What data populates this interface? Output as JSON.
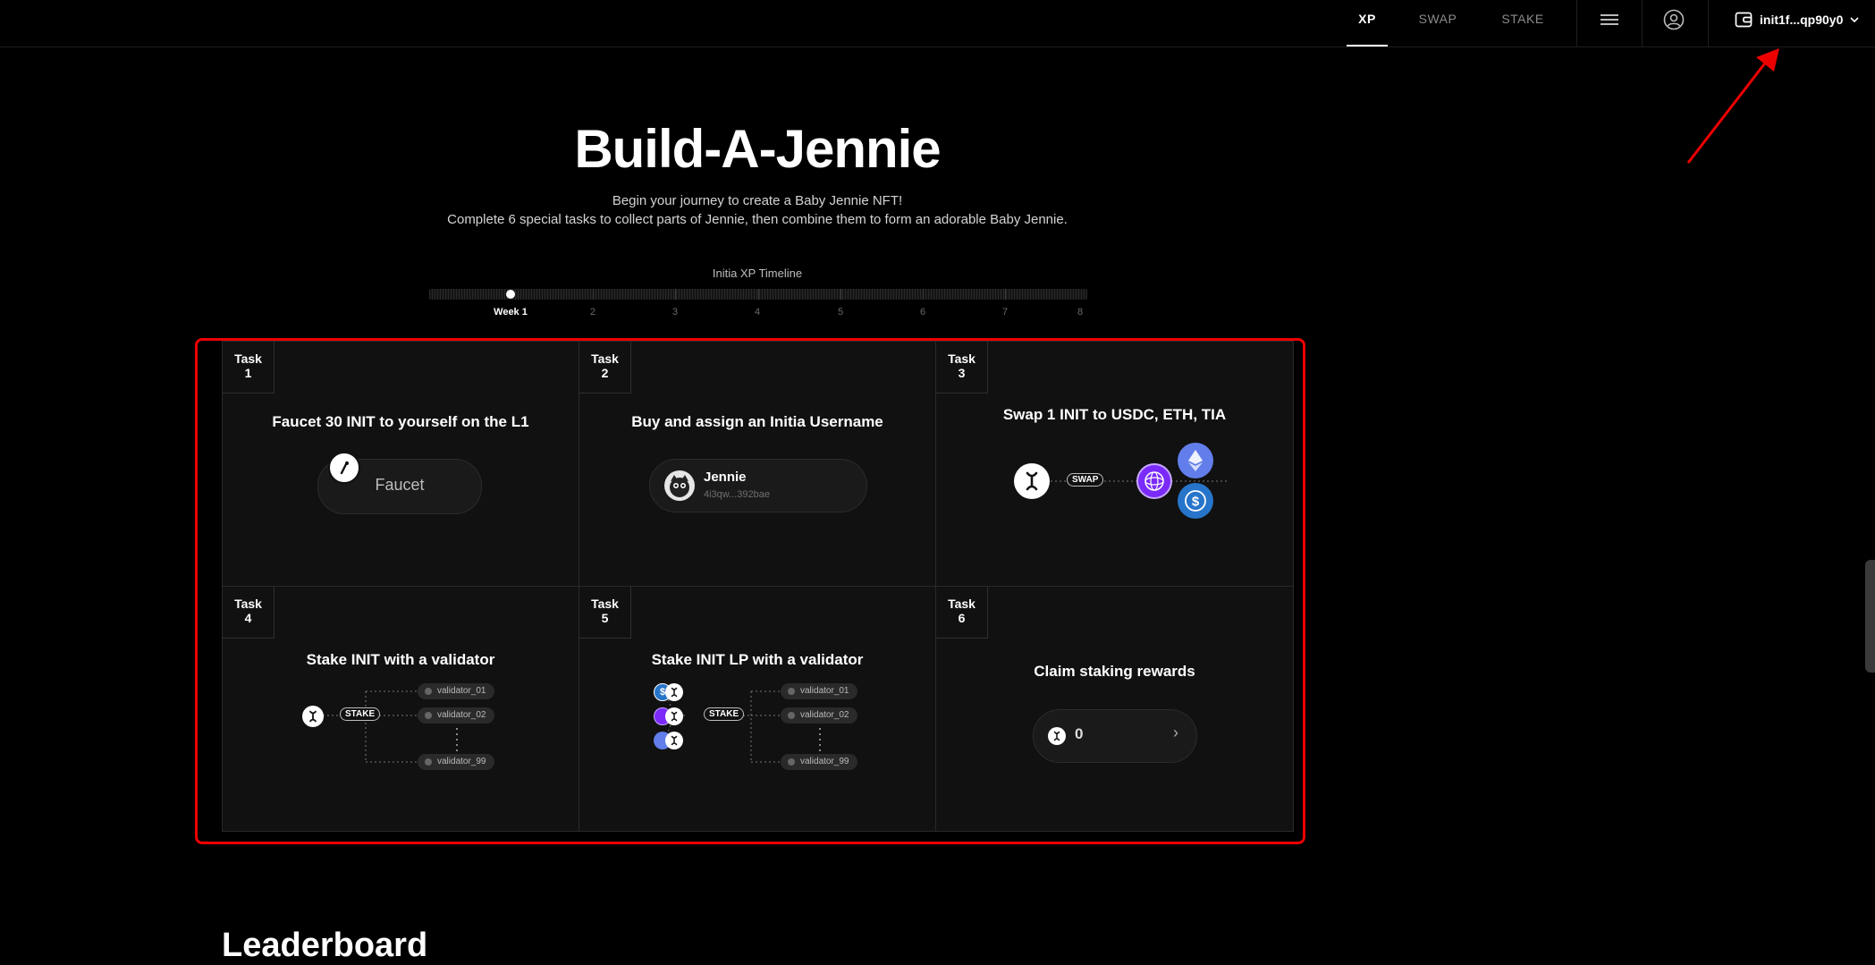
{
  "nav": {
    "tabs": [
      {
        "label": "XP",
        "active": true
      },
      {
        "label": "SWAP",
        "active": false
      },
      {
        "label": "STAKE",
        "active": false
      }
    ],
    "wallet_address": "init1f...qp90y0"
  },
  "hero": {
    "title": "Build-A-Jennie",
    "subtitle_line1": "Begin your journey to create a Baby Jennie NFT!",
    "subtitle_line2": "Complete 6 special tasks to collect parts of Jennie, then combine them to form an adorable Baby Jennie."
  },
  "timeline": {
    "label": "Initia XP Timeline",
    "weeks": [
      "Week 1",
      "2",
      "3",
      "4",
      "5",
      "6",
      "7",
      "8"
    ],
    "current_week_index": 0
  },
  "tasks": [
    {
      "badge_top": "Task",
      "badge_num": "1",
      "title": "Faucet 30 INIT to yourself on the L1",
      "button_label": "Faucet"
    },
    {
      "badge_top": "Task",
      "badge_num": "2",
      "title": "Buy and assign an Initia Username",
      "username": "Jennie",
      "address": "4i3qw...392bae"
    },
    {
      "badge_top": "Task",
      "badge_num": "3",
      "title": "Swap 1 INIT to USDC, ETH, TIA",
      "swap_label": "SWAP"
    },
    {
      "badge_top": "Task",
      "badge_num": "4",
      "title": "Stake INIT with a validator",
      "stake_label": "STAKE",
      "validators": [
        "validator_01",
        "validator_02",
        "validator_99"
      ]
    },
    {
      "badge_top": "Task",
      "badge_num": "5",
      "title": "Stake INIT LP with a validator",
      "stake_label": "STAKE",
      "validators": [
        "validator_01",
        "validator_02",
        "validator_99"
      ]
    },
    {
      "badge_top": "Task",
      "badge_num": "6",
      "title": "Claim staking rewards",
      "reward_value": "0",
      "chevron": "›"
    }
  ],
  "leaderboard": {
    "title": "Leaderboard"
  },
  "colors": {
    "highlight_outline": "#ee0000",
    "arrow": "#ee0000",
    "eth": "#627eea",
    "usdc": "#2775ca",
    "tia": "#7b2bf9"
  }
}
